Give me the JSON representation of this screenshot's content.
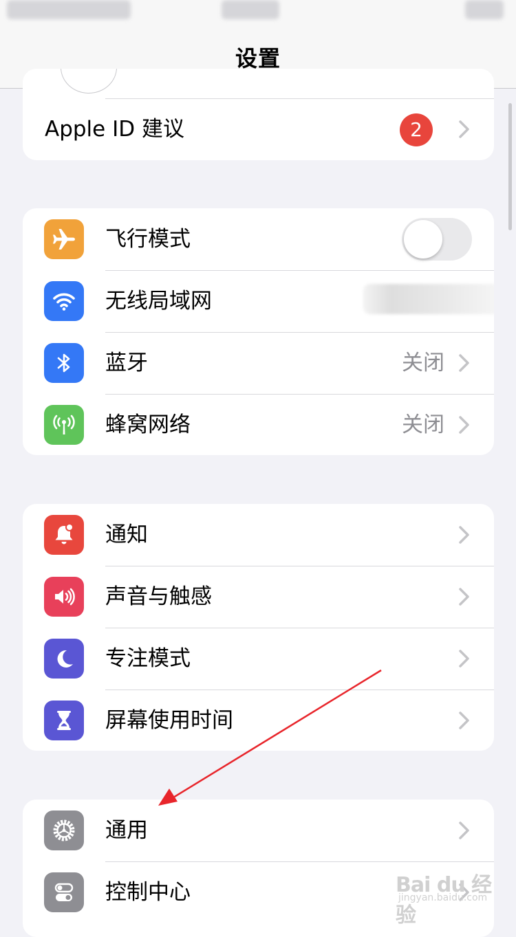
{
  "nav": {
    "title": "设置"
  },
  "apple_id": {
    "label": "Apple ID 建议",
    "badge": "2"
  },
  "connectivity": [
    {
      "label": "飞行模式",
      "icon": "airplane-icon",
      "color": "#f1a23a",
      "toggle_on": false
    },
    {
      "label": "无线局域网",
      "icon": "wifi-icon",
      "color": "#3478f6"
    },
    {
      "label": "蓝牙",
      "icon": "bluetooth-icon",
      "color": "#3478f6",
      "value": "关闭"
    },
    {
      "label": "蜂窝网络",
      "icon": "cellular-icon",
      "color": "#5fc45a",
      "value": "关闭"
    }
  ],
  "notifications": [
    {
      "label": "通知",
      "icon": "notification-bell-icon",
      "color": "#e8473d"
    },
    {
      "label": "声音与触感",
      "icon": "speaker-icon",
      "color": "#e8405a"
    },
    {
      "label": "专注模式",
      "icon": "moon-icon",
      "color": "#5a56d4"
    },
    {
      "label": "屏幕使用时间",
      "icon": "hourglass-icon",
      "color": "#5a56d4"
    }
  ],
  "general": [
    {
      "label": "通用",
      "icon": "gear-icon",
      "color": "#8e8e93"
    },
    {
      "label": "控制中心",
      "icon": "switches-icon",
      "color": "#8e8e93"
    }
  ],
  "watermark": {
    "main": "Bai du 经验",
    "sub": "jingyan.baidu.com"
  },
  "annotation": {
    "arrow_color": "#e8252b"
  }
}
